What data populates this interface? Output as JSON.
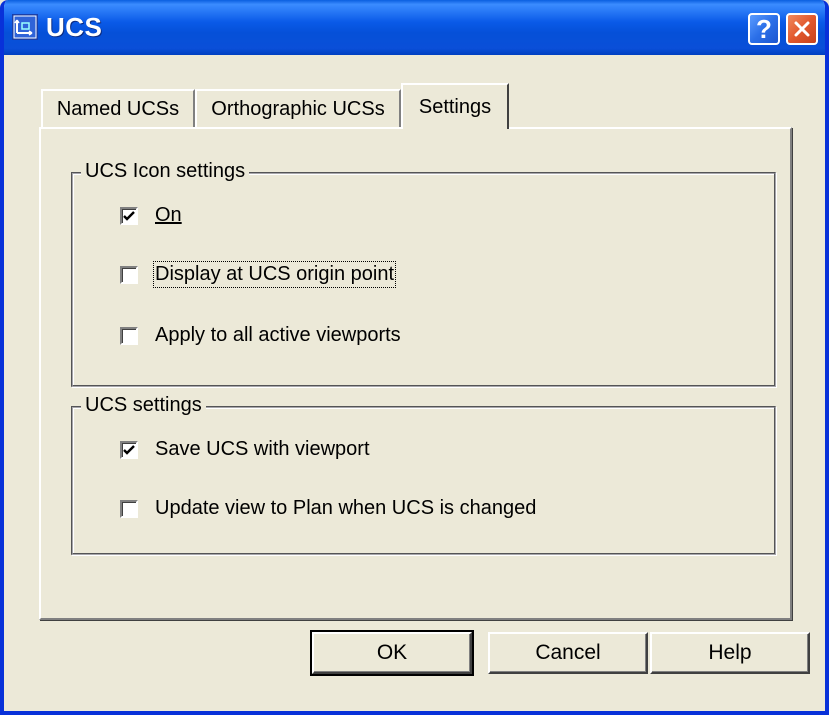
{
  "window": {
    "title": "UCS",
    "help_glyph": "?",
    "icons": {
      "app": "ucs-app-icon",
      "help": "help-icon",
      "close": "close-icon"
    }
  },
  "tabs": [
    {
      "label": "Named UCSs",
      "active": false
    },
    {
      "label": "Orthographic UCSs",
      "active": false
    },
    {
      "label": "Settings",
      "active": true
    }
  ],
  "icon_settings": {
    "title": "UCS Icon settings",
    "options": [
      {
        "label": "On",
        "checked": true
      },
      {
        "label": "Display at UCS origin point",
        "checked": false
      },
      {
        "label": "Apply to all active viewports",
        "checked": false
      }
    ]
  },
  "ucs_settings": {
    "title": "UCS settings",
    "options": [
      {
        "label": "Save UCS with viewport",
        "checked": true
      },
      {
        "label": "Update view to Plan when UCS is changed",
        "checked": false
      }
    ]
  },
  "buttons": {
    "ok": "OK",
    "cancel": "Cancel",
    "help": "Help"
  },
  "colors": {
    "titlebar": "#0a5ae8",
    "dialog_bg": "#ece9d8",
    "close_button": "#e2582d"
  }
}
